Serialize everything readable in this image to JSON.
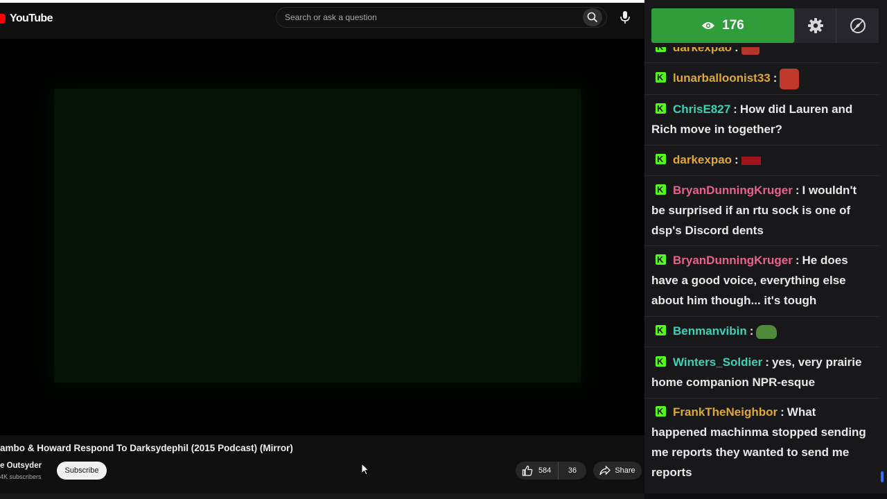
{
  "youtube": {
    "logo_text": "YouTube",
    "search_placeholder": "Search or ask a question",
    "video_title": "ambo & Howard Respond To Darksydephil (2015 Podcast) (Mirror)",
    "channel_name": "e Outsyder",
    "subscriber_count": "4K subscribers",
    "subscribe_label": "Subscribe",
    "like_count": "584",
    "dislike_count": "36",
    "share_label": "Share"
  },
  "chat": {
    "viewer_count": "176",
    "messages": [
      {
        "user": "darkexpao",
        "color": "#e0a832",
        "text": "",
        "emote": "face-emote"
      },
      {
        "user": "lunarballoonist33",
        "color": "#e0a832",
        "text": "",
        "emote": "face-emote"
      },
      {
        "user": "ChrisE827",
        "color": "#3ed1b6",
        "text": "How did Lauren and Rich move in together?"
      },
      {
        "user": "darkexpao",
        "color": "#e0a832",
        "text": "",
        "emote": "red-text-emote"
      },
      {
        "user": "BryanDunningKruger",
        "color": "#e8628b",
        "text": "I wouldn't be surprised if an rtu sock is one of dsp's Discord dents"
      },
      {
        "user": "BryanDunningKruger",
        "color": "#e8628b",
        "text": "He does have a good voice, everything else about him though... it's tough"
      },
      {
        "user": "Benmanvibin",
        "color": "#3ed1b6",
        "text": "",
        "emote": "frog-emote"
      },
      {
        "user": "Winters_Soldier",
        "color": "#3ed1b6",
        "text": "yes, very prairie home companion NPR-esque"
      },
      {
        "user": "FrankTheNeighbor",
        "color": "#e0a832",
        "text": "What happened machinma stopped sending me reports they wanted to send me reports"
      }
    ]
  },
  "colors": {
    "viewer_green": "#2f9e3a",
    "kick_green": "#53fc18",
    "yt_red": "#ff0000"
  }
}
